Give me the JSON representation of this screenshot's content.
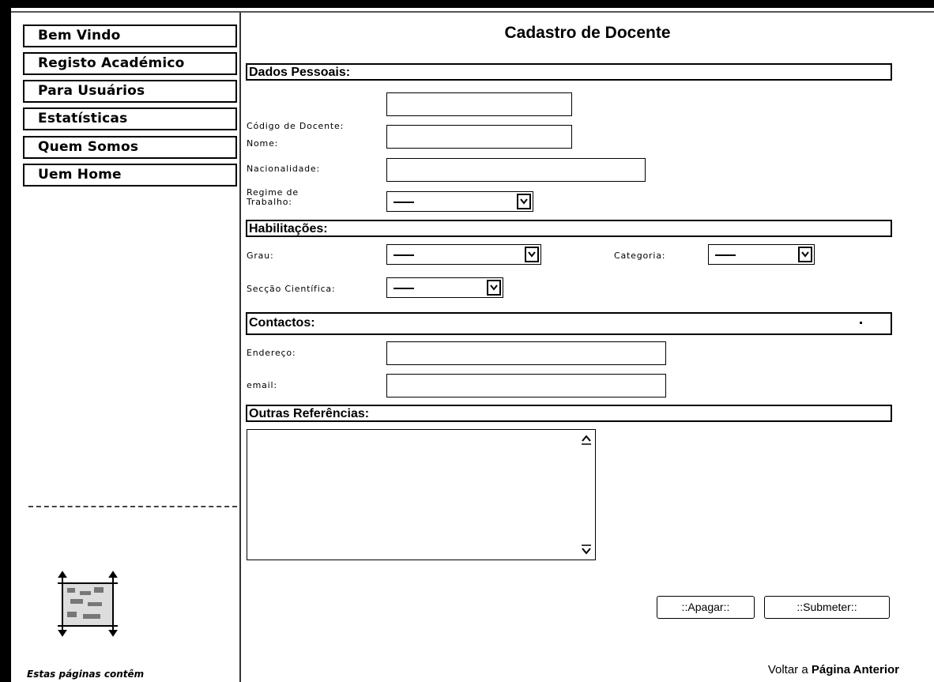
{
  "sidebar": {
    "items": [
      {
        "label": "Bem Vindo"
      },
      {
        "label": "Registo Académico"
      },
      {
        "label": "Para Usuários"
      },
      {
        "label": "Estatísticas"
      },
      {
        "label": "Quem Somos"
      },
      {
        "label": "Uem Home"
      }
    ],
    "note": "Estas páginas contêm"
  },
  "page": {
    "title": "Cadastro de Docente"
  },
  "sections": {
    "dados_pessoais": "Dados Pessoais:",
    "habilitacoes": "Habilitações:",
    "contactos": "Contactos:",
    "outras_referencias": "Outras Referências:"
  },
  "fields": {
    "codigo_docente": {
      "label": "Código de Docente:",
      "value": ""
    },
    "nome": {
      "label": "Nome:",
      "value": ""
    },
    "nacionalidade": {
      "label": "Nacionalidade:",
      "value": ""
    },
    "regime_trabalho": {
      "label_line1": "Regime de",
      "label_line2": "Trabalho:",
      "selected": "----"
    },
    "grau": {
      "label": "Grau:",
      "selected": "----"
    },
    "categoria": {
      "label": "Categoria:",
      "selected": "----"
    },
    "seccao_cientifica": {
      "label": "Secção Científica:",
      "selected": "----"
    },
    "endereco": {
      "label": "Endereço:",
      "value": ""
    },
    "email": {
      "label": "email:",
      "value": ""
    },
    "outras_referencias": {
      "value": ""
    }
  },
  "buttons": {
    "apagar": "::Apagar::",
    "submeter": "::Submeter::"
  },
  "back_link": {
    "prefix": "Voltar a ",
    "bold": "Página Anterior"
  },
  "icons": [
    "scroll-logo-icon",
    "chevron-down-icon",
    "scroll-up-icon",
    "scroll-down-icon"
  ]
}
